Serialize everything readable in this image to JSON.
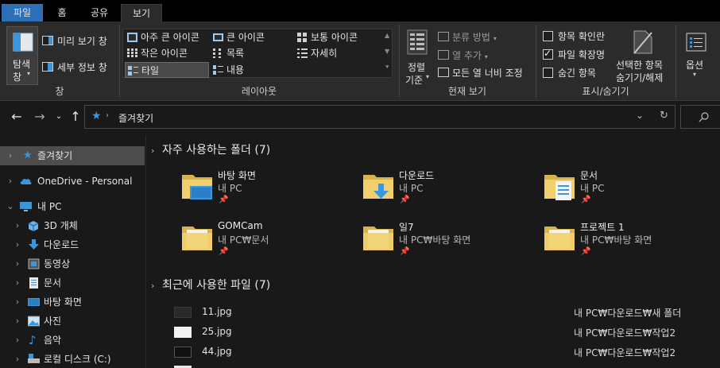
{
  "ribbon_tabs": [
    "파일",
    "홈",
    "공유",
    "보기"
  ],
  "ribbon": {
    "pane": {
      "nav_pane": "탐색",
      "nav_pane2": "창",
      "preview_pane": "미리 보기 창",
      "details_pane": "세부 정보 창",
      "group_label": "창"
    },
    "layout": {
      "items": [
        "아주 큰 아이콘",
        "큰 아이콘",
        "보통 아이콘",
        "작은 아이콘",
        "목록",
        "자세히",
        "타일",
        "내용"
      ],
      "selected": "타일",
      "group_label": "레이아웃"
    },
    "current_view": {
      "sort": "정렬",
      "sort2": "기준",
      "group_by": "분류 방법",
      "add_column": "열 추가",
      "fit_columns": "모든 열 너비 조정",
      "group_label": "현재 보기"
    },
    "show_hide": {
      "item_checkboxes": "항목 확인란",
      "file_extensions": "파일 확장명",
      "hidden_items": "숨긴 항목",
      "item_checkboxes_checked": false,
      "file_extensions_checked": true,
      "hidden_items_checked": false,
      "hide_selected": "선택한 항목",
      "hide_selected2": "숨기기/해제",
      "group_label": "표시/숨기기"
    },
    "options": "옵션"
  },
  "address": {
    "path": "즐겨찾기"
  },
  "sidebar": {
    "items": [
      {
        "label": "즐겨찾기",
        "icon": "star-icon"
      },
      {
        "label": "OneDrive - Personal",
        "icon": "cloud-icon"
      },
      {
        "label": "내 PC",
        "icon": "computer-icon"
      },
      {
        "label": "3D 개체",
        "icon": "cube-icon"
      },
      {
        "label": "다운로드",
        "icon": "download-icon"
      },
      {
        "label": "동영상",
        "icon": "video-icon"
      },
      {
        "label": "문서",
        "icon": "document-icon"
      },
      {
        "label": "바탕 화면",
        "icon": "desktop-icon"
      },
      {
        "label": "사진",
        "icon": "pictures-icon"
      },
      {
        "label": "음악",
        "icon": "music-icon"
      },
      {
        "label": "로컬 디스크 (C:)",
        "icon": "disk-icon"
      }
    ]
  },
  "frequent": {
    "header": "자주 사용하는 폴더 (7)",
    "folders": [
      {
        "name": "바탕 화면",
        "path": "내 PC",
        "icon": "desktop-folder-icon"
      },
      {
        "name": "다운로드",
        "path": "내 PC",
        "icon": "download-folder-icon"
      },
      {
        "name": "문서",
        "path": "내 PC",
        "icon": "document-folder-icon"
      },
      {
        "name": "GOMCam",
        "path": "내 PC₩문서",
        "icon": "folder-icon"
      },
      {
        "name": "일7",
        "path": "내 PC₩바탕 화면",
        "icon": "folder-icon"
      },
      {
        "name": "프로젝트 1",
        "path": "내 PC₩바탕 화면",
        "icon": "folder-icon"
      }
    ]
  },
  "recent": {
    "header": "최근에 사용한 파일 (7)",
    "files": [
      {
        "name": "11.jpg",
        "path": "내 PC₩다운로드₩새 폴더"
      },
      {
        "name": "25.jpg",
        "path": "내 PC₩다운로드₩작업2"
      },
      {
        "name": "44.jpg",
        "path": "내 PC₩다운로드₩작업2"
      }
    ]
  },
  "colors": {
    "accent": "#3a96dd",
    "folder": "#e8c25e",
    "selection": "#4d4d4d"
  }
}
